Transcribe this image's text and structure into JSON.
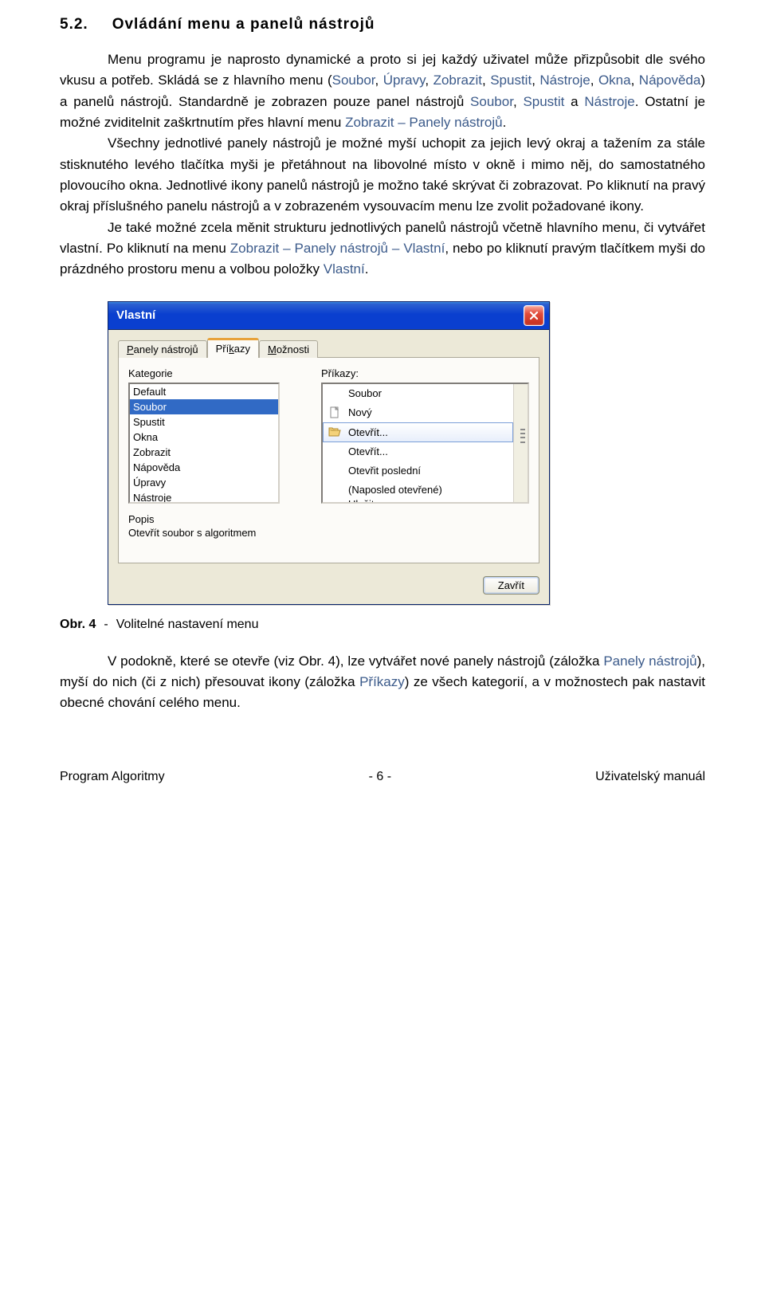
{
  "heading": {
    "number": "5.2.",
    "title": "Ovládání menu a panelů nástrojů"
  },
  "paragraphs": {
    "p1a": "Menu programu je naprosto dynamické a proto si jej každý uživatel může přizpůsobit dle svého vkusu a potřeb. Skládá se z hlavního menu (",
    "p1_menu1": "Soubor",
    "p1_sep": ", ",
    "p1_menu2": "Úpravy",
    "p1_menu3": "Zobrazit",
    "p1_menu4": "Spustit",
    "p1_menu5": "Nástroje",
    "p1_menu6": "Okna",
    "p1_menu7": "Nápověda",
    "p1b": ") a panelů nástrojů. Standardně je zobrazen pouze panel nástrojů ",
    "p1_tool1": "Soubor",
    "p1_tool2": "Spustit",
    "p1_and": " a ",
    "p1_tool3": "Nástroje",
    "p1c": ". Ostatní je možné zviditelnit zaškrtnutím přes hlavní menu ",
    "p1_path1": "Zobrazit – Panely nástrojů",
    "p1d": ".",
    "p2": "Všechny jednotlivé panely nástrojů je možné myší uchopit za jejich levý okraj a tažením za stále stisknutého levého tlačítka myši je přetáhnout na libovolné místo v okně i mimo něj, do samostatného plovoucího okna. Jednotlivé ikony panelů nástrojů je možno také skrývat či zobrazovat. Po kliknutí na pravý okraj příslušného panelu nástrojů a v zobrazeném vysouvacím menu lze zvolit požadované ikony.",
    "p3a": "Je také možné zcela měnit strukturu jednotlivých panelů nástrojů včetně hlavního menu, či vytvářet vlastní. Po kliknutí na menu ",
    "p3_path": "Zobrazit – Panely nástrojů – Vlastní",
    "p3b": ", nebo po kliknutí pravým tlačítkem myši do prázdného prostoru menu a volbou položky ",
    "p3_item": "Vlastní",
    "p3c": "."
  },
  "dialog": {
    "title": "Vlastní",
    "tabs": {
      "t1": "Panely nástrojů",
      "t2": "Příkazy",
      "t3": "Možnosti"
    },
    "labels": {
      "category": "Kategorie",
      "commands": "Příkazy:",
      "desc": "Popis",
      "desc_text": "Otevřít soubor s algoritmem"
    },
    "categories": [
      "Default",
      "Soubor",
      "Spustit",
      "Okna",
      "Zobrazit",
      "Nápověda",
      "Úpravy",
      "Nástroje"
    ],
    "commands": [
      "Soubor",
      "Nový",
      "Otevřít...",
      "Otevřít...",
      "Otevřit poslední",
      "(Naposled otevřené)",
      "Uložit"
    ],
    "close_btn": "Zavřít"
  },
  "caption": {
    "label": "Obr. 4",
    "dash": "-",
    "text": "Volitelné nastavení menu"
  },
  "after": {
    "p1a": "V podokně, které se otevře (viz ",
    "p1_ref": "Obr. 4",
    "p1b": "), lze vytvářet nové panely nástrojů (záložka ",
    "p1_tab1": "Panely nástrojů",
    "p1c": "), myší do nich (či z nich) přesouvat ikony (záložka ",
    "p1_tab2": "Příkazy",
    "p1d": ") ze všech kategorií, a v možnostech pak nastavit obecné chování celého menu."
  },
  "footer": {
    "left": "Program Algoritmy",
    "center": "- 6 -",
    "right": "Uživatelský manuál"
  }
}
